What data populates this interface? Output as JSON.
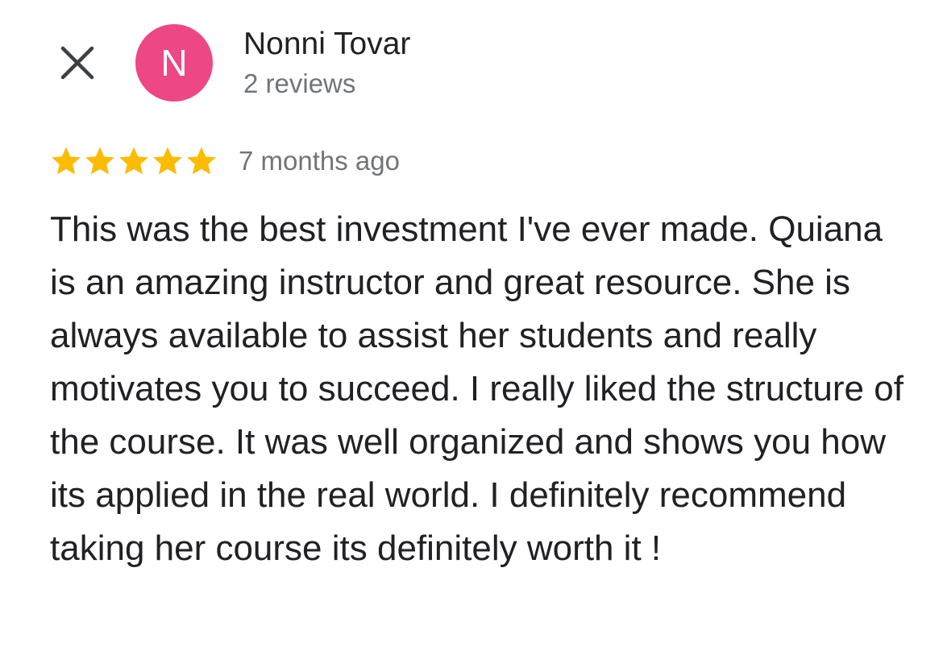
{
  "colors": {
    "avatar_bg": "#ee4785",
    "star": "#fbbc04",
    "secondary_text": "#70757a",
    "primary_text": "#202124"
  },
  "icons": {
    "close": "close-icon",
    "star": "star-icon"
  },
  "reviewer": {
    "initial": "N",
    "name": "Nonni Tovar",
    "review_count": "2 reviews"
  },
  "review": {
    "rating": 5,
    "max_rating": 5,
    "time": "7 months ago",
    "text": "This was the best investment I've ever made. Quiana is an amazing instructor and great resource. She is always available to assist her students and really motivates you to succeed. I really liked the structure of the course. It was well organized and shows you how its applied in the real world. I definitely recommend taking her course its definitely worth it !"
  }
}
